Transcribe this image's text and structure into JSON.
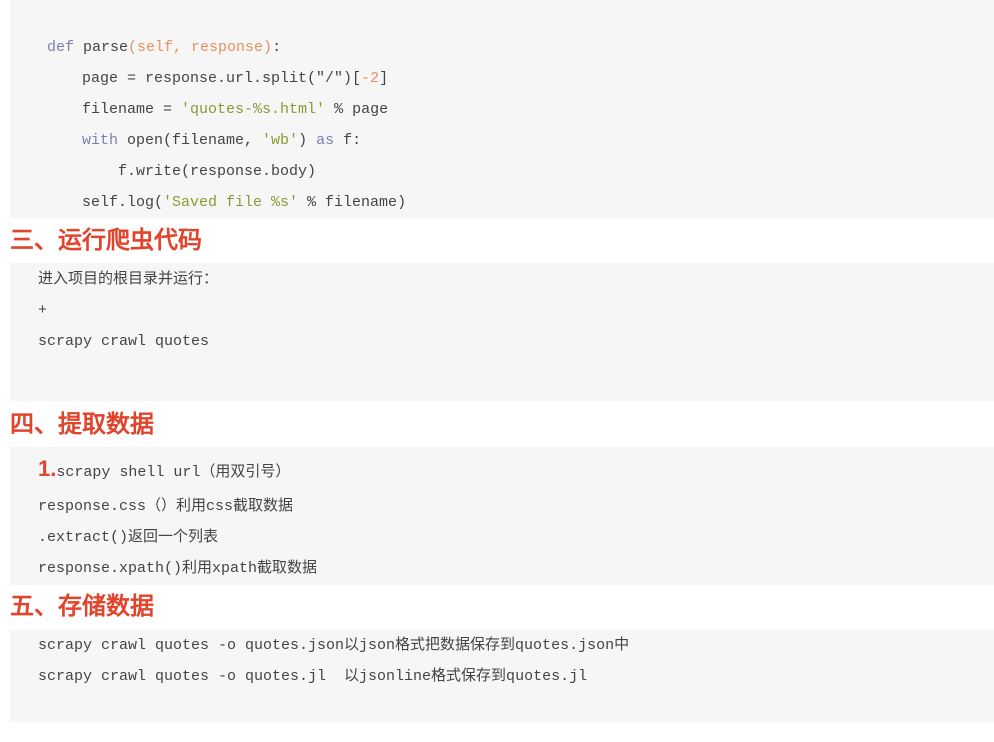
{
  "code_block": {
    "lines": [
      {
        "kw": "def",
        "rest1": " parse",
        "args": "(self, response)",
        "rest2": ":"
      },
      {
        "a": "page = response.url.split(\"/\")[",
        "num": "-2",
        "b": "]"
      },
      {
        "a": "filename = ",
        "str": "'quotes-%s.html'",
        "b": " % page"
      },
      {
        "kw": "with",
        "a": " open(filename, ",
        "str": "'wb'",
        "b": ") ",
        "kw2": "as",
        "c": " f:"
      },
      {
        "a": "f.write(response.body)"
      },
      {
        "a": "self.log(",
        "str": "'Saved file %s'",
        "b": " % filename)"
      }
    ]
  },
  "sections": [
    {
      "heading": "三、运行爬虫代码",
      "lines": [
        "进入项目的根目录并运行：",
        "+",
        "scrapy crawl quotes"
      ]
    },
    {
      "heading": "四、提取数据",
      "number": "1.",
      "first": "scrapy shell url（用双引号）",
      "lines": [
        "response.css（）利用css截取数据",
        ".extract()返回一个列表",
        "response.xpath()利用xpath截取数据"
      ]
    },
    {
      "heading": "五、存储数据",
      "lines": [
        "scrapy crawl quotes -o quotes.json以json格式把数据保存到quotes.json中",
        "scrapy crawl quotes -o quotes.jl  以jsonline格式保存到quotes.jl"
      ]
    }
  ],
  "colors": {
    "heading": "#e0442c",
    "keyword": "#7d7fb0",
    "argument": "#e6915e",
    "string": "#8a9a34",
    "block_bg": "#f6f6f6"
  }
}
